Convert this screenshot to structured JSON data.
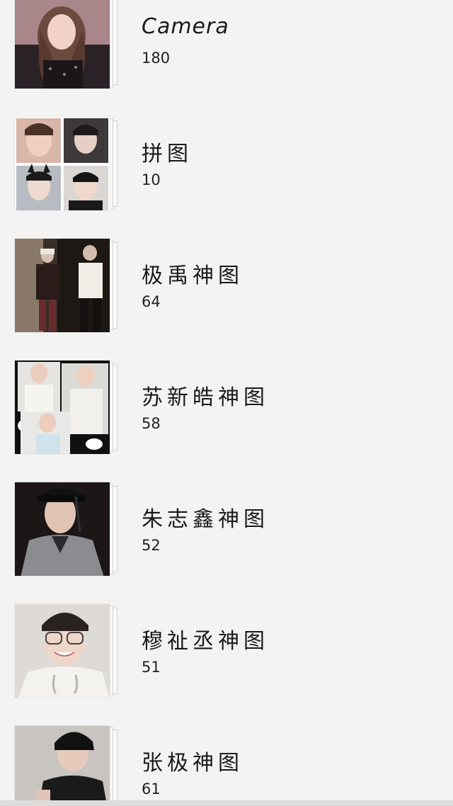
{
  "albums": [
    {
      "name": "Camera",
      "count": "180",
      "thumb_icon": "portrait-photo"
    },
    {
      "name": "拼图",
      "count": "10",
      "thumb_icon": "collage-photo"
    },
    {
      "name": "极禹神图",
      "count": "64",
      "thumb_icon": "two-people-photo"
    },
    {
      "name": "苏新皓神图",
      "count": "58",
      "thumb_icon": "collage-photo"
    },
    {
      "name": "朱志鑫神图",
      "count": "52",
      "thumb_icon": "portrait-photo"
    },
    {
      "name": "穆祉丞神图",
      "count": "51",
      "thumb_icon": "portrait-photo"
    },
    {
      "name": "张极神图",
      "count": "61",
      "thumb_icon": "portrait-photo"
    }
  ],
  "colors": {
    "background": "#f3f3f3",
    "text": "#1a1a1a"
  }
}
